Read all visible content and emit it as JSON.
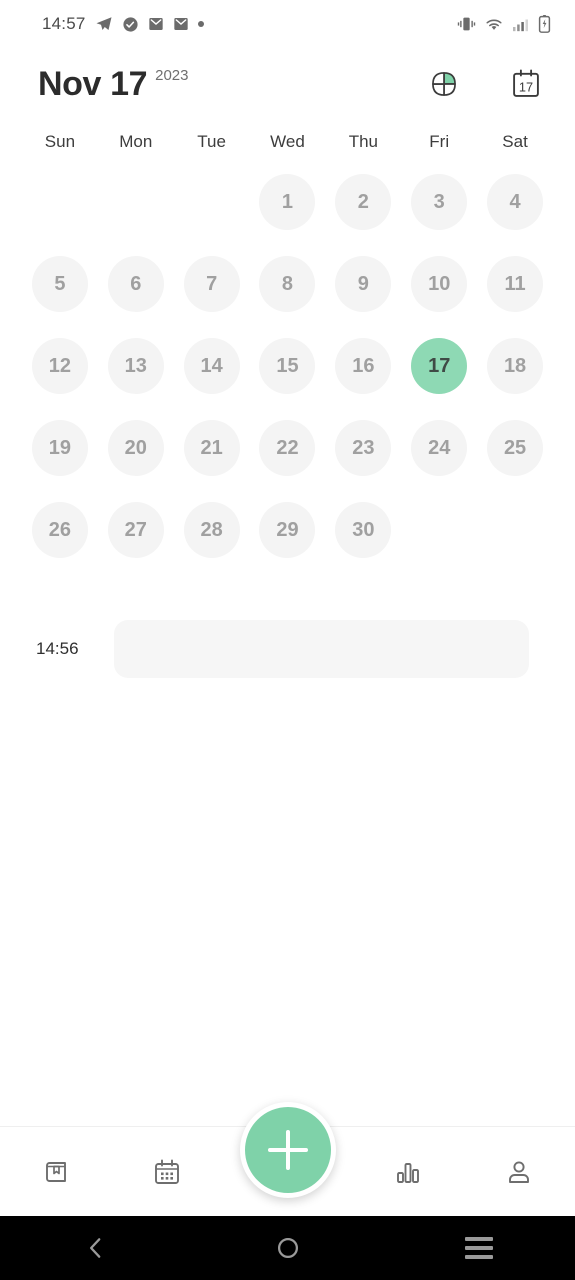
{
  "status_bar": {
    "time": "14:57",
    "left_icons": [
      "telegram-icon",
      "check-circle-icon",
      "mail-icon",
      "mail-icon",
      "dot-icon"
    ],
    "right_icons": [
      "vibrate-icon",
      "wifi-icon",
      "cellular-signal-icon",
      "battery-charging-icon"
    ]
  },
  "header": {
    "title": "Nov 17",
    "year": "2023",
    "actions": [
      {
        "name": "pinwheel-icon",
        "accent": "#7fd2a9"
      },
      {
        "name": "calendar-day-icon",
        "label": "17"
      }
    ]
  },
  "calendar": {
    "weekdays": [
      "Sun",
      "Mon",
      "Tue",
      "Wed",
      "Thu",
      "Fri",
      "Sat"
    ],
    "month": "November",
    "year": "2023",
    "leading_blanks": 3,
    "days": [
      1,
      2,
      3,
      4,
      5,
      6,
      7,
      8,
      9,
      10,
      11,
      12,
      13,
      14,
      15,
      16,
      17,
      18,
      19,
      20,
      21,
      22,
      23,
      24,
      25,
      26,
      27,
      28,
      29,
      30
    ],
    "selected_day": 17,
    "colors": {
      "day_background": "#f4f4f4",
      "day_text": "#a0a0a0",
      "selected_background": "#8ed9b4",
      "selected_text": "#3f4a45"
    }
  },
  "entries": [
    {
      "time": "14:56",
      "content": ""
    }
  ],
  "fab": {
    "name": "add-entry-button",
    "glyph": "+",
    "color": "#7fd2a9"
  },
  "bottom_nav": [
    {
      "name": "nav-journal",
      "icon": "book-bookmark-icon"
    },
    {
      "name": "nav-calendar",
      "icon": "calendar-grid-icon"
    },
    {
      "name": "nav-stats",
      "icon": "bar-chart-icon"
    },
    {
      "name": "nav-profile",
      "icon": "person-icon"
    }
  ],
  "android_nav": [
    {
      "name": "back-button",
      "icon": "chevron-left-icon"
    },
    {
      "name": "home-button",
      "icon": "circle-icon"
    },
    {
      "name": "recents-button",
      "icon": "menu-lines-icon"
    }
  ]
}
